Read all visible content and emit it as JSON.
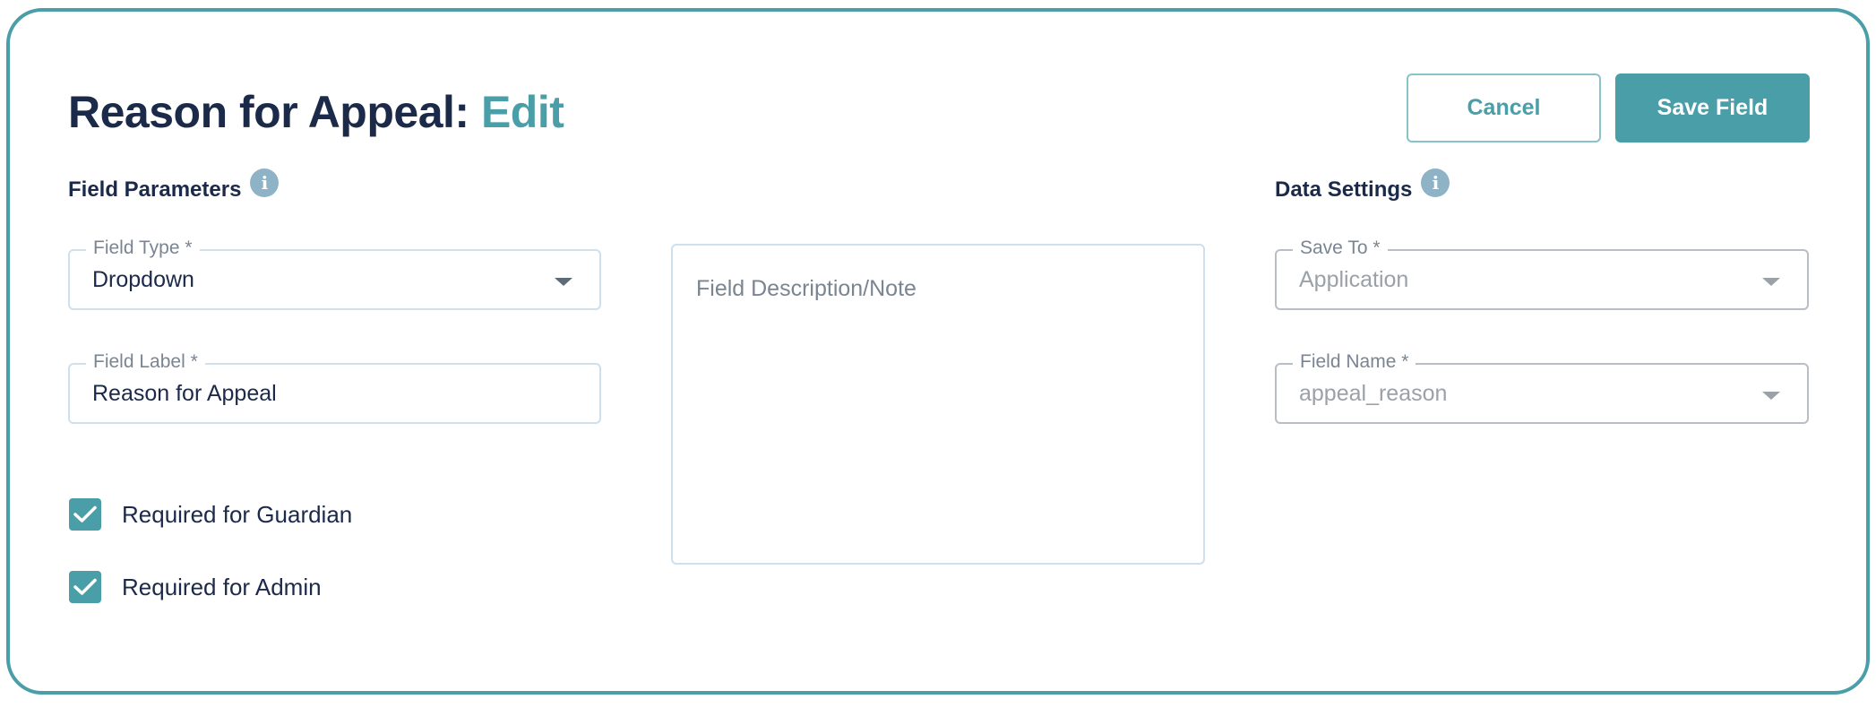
{
  "header": {
    "title": "Reason for Appeal:",
    "title_mode": "Edit"
  },
  "actions": {
    "cancel_label": "Cancel",
    "save_label": "Save Field"
  },
  "field_parameters": {
    "heading": "Field Parameters",
    "info_icon": "info-icon",
    "field_type": {
      "label": "Field Type *",
      "value": "Dropdown"
    },
    "field_label": {
      "label": "Field Label *",
      "value": "Reason for Appeal"
    },
    "description": {
      "placeholder": "Field Description/Note"
    },
    "checkboxes": [
      {
        "label": "Required for Guardian",
        "checked": true
      },
      {
        "label": "Required for Admin",
        "checked": true
      }
    ]
  },
  "data_settings": {
    "heading": "Data Settings",
    "info_icon": "info-icon",
    "save_to": {
      "label": "Save To *",
      "value": "Application"
    },
    "field_name": {
      "label": "Field Name *",
      "value": "appeal_reason"
    }
  },
  "colors": {
    "accent": "#4a9ea8",
    "heading_text": "#1c2a4a",
    "info_icon": "#8fb3c6"
  }
}
